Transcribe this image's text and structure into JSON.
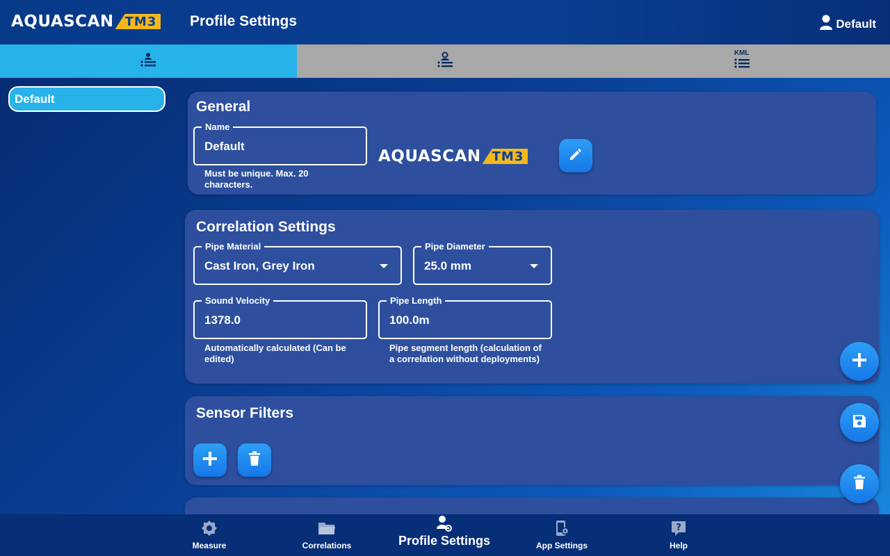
{
  "header": {
    "logo_text": "AQUASCAN",
    "logo_badge": "TM3",
    "title": "Profile Settings",
    "user_name": "Default"
  },
  "tabs": [
    {
      "label": "",
      "icon": "profile-list-icon",
      "active": true
    },
    {
      "label": "",
      "icon": "sensor-profile-list-icon",
      "active": false
    },
    {
      "label": "KML",
      "icon": "kml-list-icon",
      "active": false
    }
  ],
  "sidebar": {
    "profiles": [
      {
        "label": "Default",
        "selected": true
      }
    ]
  },
  "general": {
    "title": "General",
    "name_label": "Name",
    "name_value": "Default",
    "name_helper": "Must be unique. Max. 20 characters.",
    "logo_text": "AQUASCAN",
    "logo_badge": "TM3"
  },
  "correlation": {
    "title": "Correlation Settings",
    "pipe_material_label": "Pipe Material",
    "pipe_material_value": "Cast Iron, Grey Iron",
    "pipe_diameter_label": "Pipe Diameter",
    "pipe_diameter_value": "25.0 mm",
    "sound_velocity_label": "Sound Velocity",
    "sound_velocity_value": "1378.0",
    "sound_velocity_helper": "Automatically calculated (Can be edited)",
    "pipe_length_label": "Pipe Length",
    "pipe_length_value": "100.0m",
    "pipe_length_helper": "Pipe segment length (calculation of a correlation without deployments)"
  },
  "sensor_filters": {
    "title": "Sensor Filters"
  },
  "bottom_nav": [
    {
      "label": "Measure",
      "icon": "measure-icon",
      "active": false
    },
    {
      "label": "Correlations",
      "icon": "folder-icon",
      "active": false
    },
    {
      "label": "Profile Settings",
      "icon": "profile-settings-icon",
      "active": true
    },
    {
      "label": "App Settings",
      "icon": "app-settings-icon",
      "active": false
    },
    {
      "label": "Help",
      "icon": "help-icon",
      "active": false
    }
  ],
  "colors": {
    "accent": "#27b2ea",
    "card": "#2d4f9e",
    "button": "#1e88ee",
    "logo_badge": "#f5b81c",
    "tab_inactive": "#a8a8a8"
  }
}
